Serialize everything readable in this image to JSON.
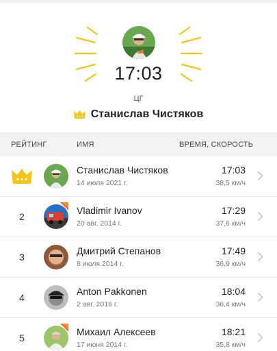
{
  "hero": {
    "time": "17:03",
    "code": "ЦГ",
    "name": "Станислав Чистяков",
    "accent_color": "#f5c518"
  },
  "table": {
    "col_rank": "РЕЙТИНГ",
    "col_name": "ИМЯ",
    "col_time": "ВРЕМЯ, СКОРОСТЬ"
  },
  "rows": [
    {
      "rank": "",
      "leader": true,
      "name": "Станислав Чистяков",
      "date": "14 июля 2021 г.",
      "time": "17:03",
      "speed": "38,5 км/ч",
      "badge": false
    },
    {
      "rank": "2",
      "leader": false,
      "name": "Vladimir Ivanov",
      "date": "20 авг. 2014 г.",
      "time": "17:29",
      "speed": "37,6 км/ч",
      "badge": true
    },
    {
      "rank": "3",
      "leader": false,
      "name": "Дмитрий Степанов",
      "date": "8 июля 2014 г.",
      "time": "17:49",
      "speed": "36,9 км/ч",
      "badge": false
    },
    {
      "rank": "4",
      "leader": false,
      "name": "Anton Pakkonen",
      "date": "2 авг. 2016 г.",
      "time": "18:04",
      "speed": "36,4 км/ч",
      "badge": false
    },
    {
      "rank": "5",
      "leader": false,
      "name": "Михаил Алексеев",
      "date": "17 июня 2014 г.",
      "time": "18:21",
      "speed": "35,8 км/ч",
      "badge": true
    }
  ],
  "icons": {
    "crown": "crown-icon",
    "chevron": "chevron-right-icon",
    "badge": "subscriber-badge-icon"
  }
}
